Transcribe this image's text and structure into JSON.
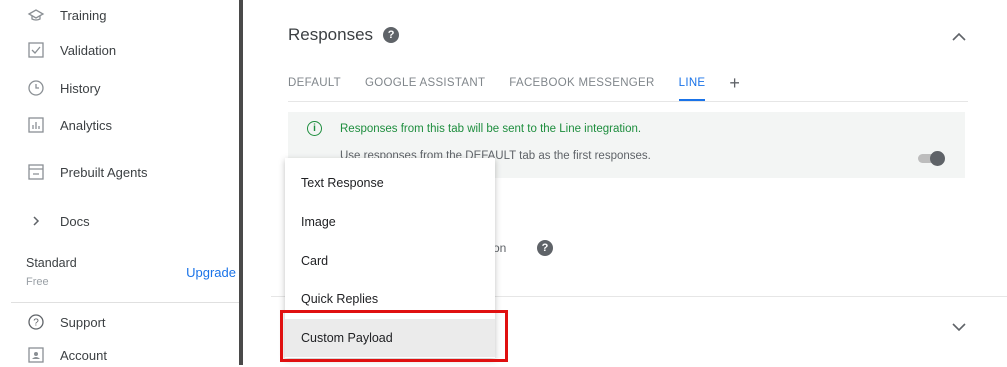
{
  "sidebar": {
    "items": [
      {
        "label": "Training",
        "icon": "training-icon"
      },
      {
        "label": "Validation",
        "icon": "validation-icon"
      },
      {
        "label": "History",
        "icon": "history-icon"
      },
      {
        "label": "Analytics",
        "icon": "analytics-icon"
      },
      {
        "label": "Prebuilt Agents",
        "icon": "prebuilt-agents-icon"
      },
      {
        "label": "Docs",
        "icon": "chevron-right-icon"
      },
      {
        "label": "Support",
        "icon": "help-circle-icon"
      },
      {
        "label": "Account",
        "icon": "account-icon"
      }
    ],
    "plan": {
      "name": "Standard",
      "tier": "Free",
      "upgrade_label": "Upgrade"
    }
  },
  "responses": {
    "title": "Responses",
    "tabs": [
      "DEFAULT",
      "GOOGLE ASSISTANT",
      "FACEBOOK MESSENGER",
      "LINE"
    ],
    "active_tab": "LINE",
    "add_tab_label": "+",
    "info_text": "Responses from this tab will be sent to the Line integration.",
    "info_subtext": "Use responses from the DEFAULT tab as the first responses.",
    "toggle_on": false,
    "partial_text": "on"
  },
  "menu": {
    "items": [
      "Text Response",
      "Image",
      "Card",
      "Quick Replies",
      "Custom Payload"
    ],
    "highlighted": "Custom Payload"
  },
  "colors": {
    "accent": "#1a73e8",
    "success": "#1e8e3e",
    "highlight_border": "#e01010"
  }
}
